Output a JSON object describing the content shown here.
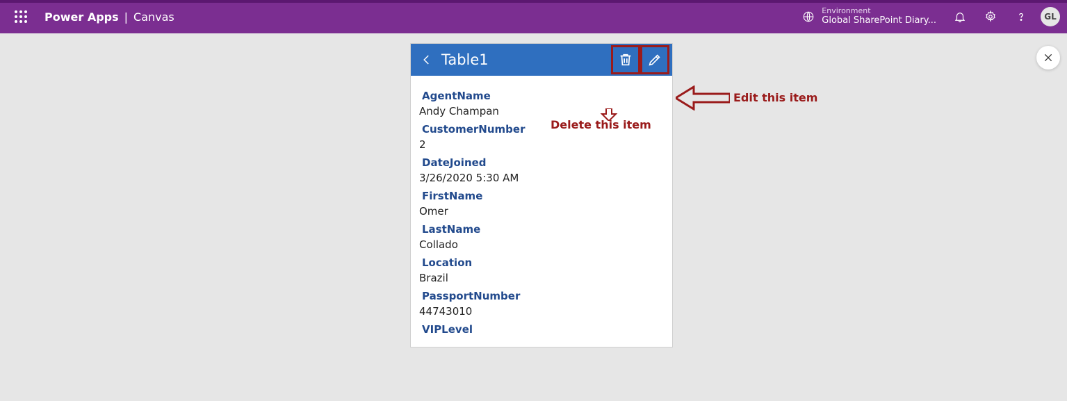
{
  "header": {
    "brand": "Power Apps",
    "separator": "|",
    "sub": "Canvas",
    "env_label": "Environment",
    "env_name": "Global SharePoint Diary...",
    "avatar": "GL"
  },
  "phone": {
    "title": "Table1",
    "fields": {
      "agent_name_label": "AgentName",
      "agent_name_value": "Andy Champan",
      "customer_number_label": "CustomerNumber",
      "customer_number_value": "2",
      "date_joined_label": "DateJoined",
      "date_joined_value": "3/26/2020 5:30 AM",
      "first_name_label": "FirstName",
      "first_name_value": "Omer",
      "last_name_label": "LastName",
      "last_name_value": "Collado",
      "location_label": "Location",
      "location_value": "Brazil",
      "passport_label": "PassportNumber",
      "passport_value": "44743010",
      "vip_label": "VIPLevel"
    }
  },
  "annotations": {
    "delete": "Delete this item",
    "edit": "Edit this item"
  }
}
